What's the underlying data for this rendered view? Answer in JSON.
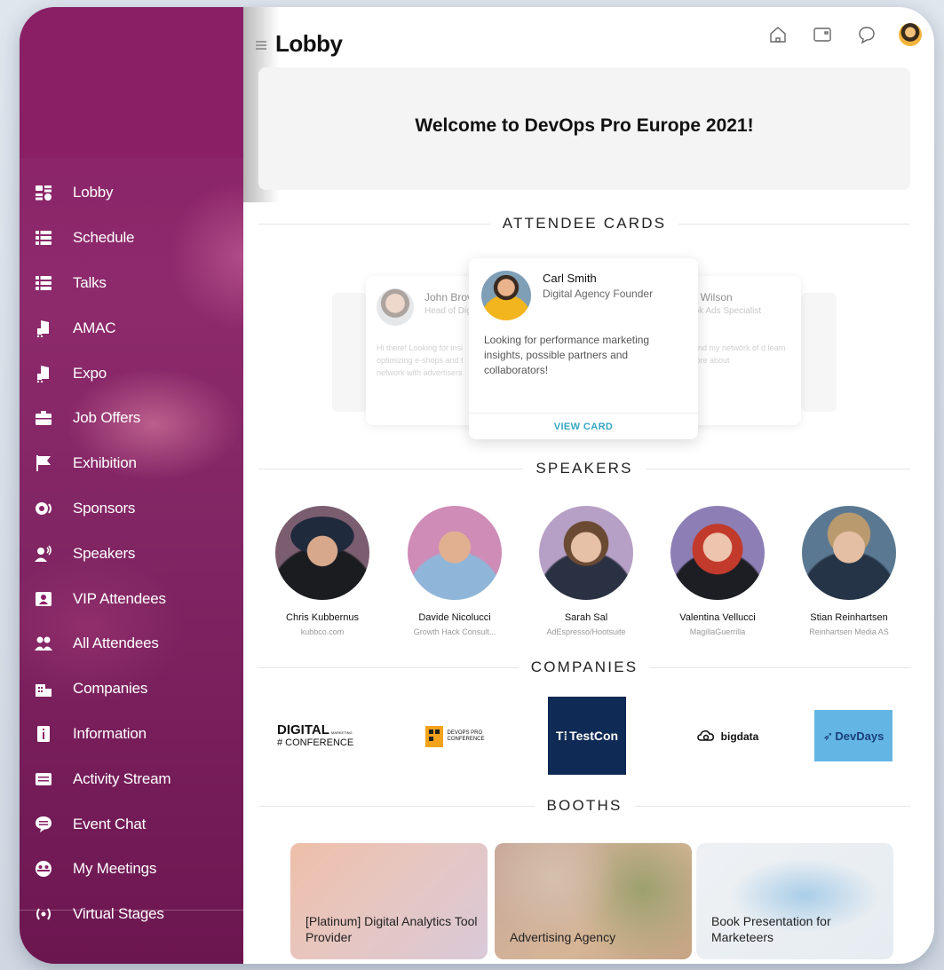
{
  "sidebar": {
    "items": [
      {
        "label": "Lobby",
        "icon": "lobby-icon"
      },
      {
        "label": "Schedule",
        "icon": "list-icon"
      },
      {
        "label": "Talks",
        "icon": "list-icon"
      },
      {
        "label": "AMAC",
        "icon": "booth-icon"
      },
      {
        "label": "Expo",
        "icon": "booth-icon"
      },
      {
        "label": "Job Offers",
        "icon": "briefcase-icon"
      },
      {
        "label": "Exhibition",
        "icon": "flag-icon"
      },
      {
        "label": "Sponsors",
        "icon": "sponsor-icon"
      },
      {
        "label": "Speakers",
        "icon": "speaker-icon"
      },
      {
        "label": "VIP Attendees",
        "icon": "vip-icon"
      },
      {
        "label": "All Attendees",
        "icon": "people-icon"
      },
      {
        "label": "Companies",
        "icon": "building-icon"
      },
      {
        "label": "Information",
        "icon": "info-icon"
      },
      {
        "label": "Activity Stream",
        "icon": "stream-icon"
      },
      {
        "label": "Event Chat",
        "icon": "chat-icon"
      },
      {
        "label": "My Meetings",
        "icon": "meetings-icon"
      },
      {
        "label": "Virtual Stages",
        "icon": "broadcast-icon"
      }
    ]
  },
  "header": {
    "title": "Lobby",
    "icons": [
      "home-icon",
      "wallet-icon",
      "chat-bubble-icon",
      "user-avatar"
    ]
  },
  "welcome": {
    "text": "Welcome to DevOps Pro Europe 2021!"
  },
  "sections": {
    "attendee_cards": "ATTENDEE CARDS",
    "speakers": "SPEAKERS",
    "companies": "COMPANIES",
    "booths": "BOOTHS"
  },
  "attendee_cards": {
    "left": {
      "name": "John Brov",
      "role": "Head of Dig",
      "text": "Hi there! Looking for insi optimizing e-shops and t network with advertisers"
    },
    "center": {
      "name": "Carl Smith",
      "role": "Digital Agency Founder",
      "text": "Looking for performance marketing insights, possible partners and collaborators!",
      "button": "VIEW CARD"
    },
    "right": {
      "name": "ia Wilson",
      "role": "ook Ads Specialist",
      "text": "pand my network of d learn more about"
    }
  },
  "speakers": [
    {
      "name": "Chris Kubbernus",
      "company": "kubbco.com"
    },
    {
      "name": "Davide Nicolucci",
      "company": "Growth Hack Consult..."
    },
    {
      "name": "Sarah Sal",
      "company": "AdEspresso/Hootsuite"
    },
    {
      "name": "Valentina Vellucci",
      "company": "MagillaGuerrilla"
    },
    {
      "name": "Stian Reinhartsen",
      "company": "Reinhartsen Media AS"
    }
  ],
  "companies": [
    {
      "logo_main": "DIGITAL",
      "logo_small": "MARKETING",
      "logo_sub": "# CONFERENCE"
    },
    {
      "logo_text": "DEVOPS PRO CONFERENCE"
    },
    {
      "logo_text": "TestCon"
    },
    {
      "logo_text": "bigdata"
    },
    {
      "logo_text": "DevDays"
    }
  ],
  "booths": [
    {
      "label": "[Platinum] Digital Analytics Tool Provider"
    },
    {
      "label": "Advertising Agency"
    },
    {
      "label": "Book Presentation for Marketeers"
    }
  ],
  "colors": {
    "sidebar": "#8a1f66",
    "accent_link": "#35a7c4",
    "testcon_bg": "#0f2a55",
    "devdays_bg": "#63b6e3"
  }
}
